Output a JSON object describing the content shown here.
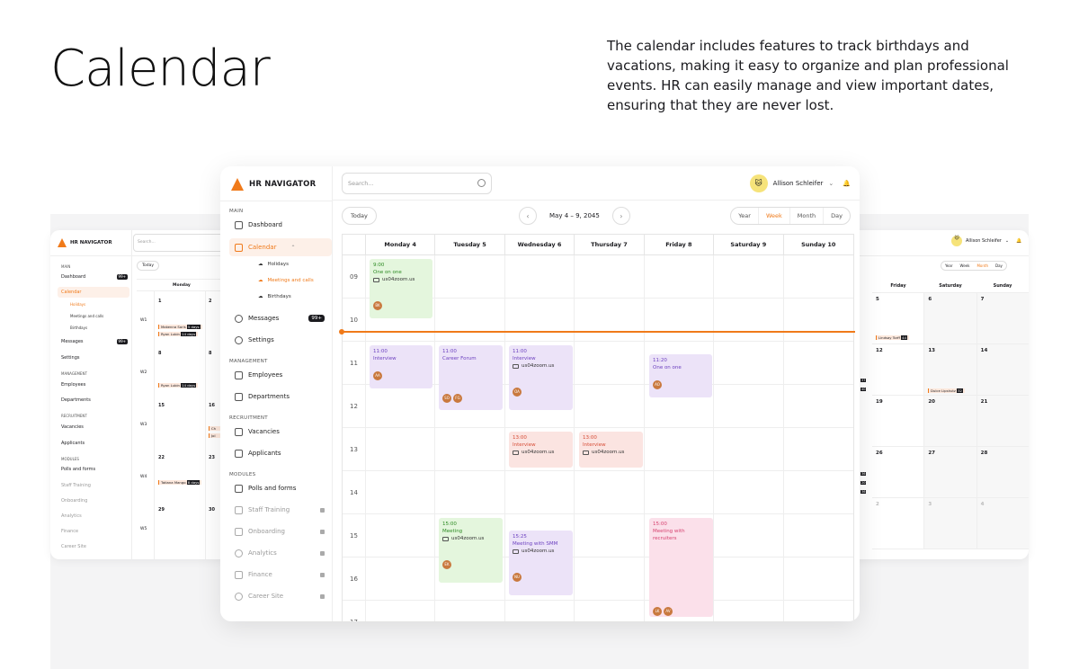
{
  "hero": {
    "title": "Calendar",
    "description": "The calendar includes features to track birthdays and vacations, making it easy to organize and plan professional events. HR can easily manage and view important dates, ensuring that they are never lost."
  },
  "app": {
    "name": "HR NAVIGATOR"
  },
  "search": {
    "placeholder": "Search..."
  },
  "user": {
    "name": "Allison Schleifer"
  },
  "sidebar": {
    "main_label": "MAIN",
    "dashboard": "Dashboard",
    "calendar": "Calendar",
    "holidays": "Holidays",
    "meetings": "Meetings and calls",
    "birthdays": "Birthdays",
    "messages": "Messages",
    "messages_badge": "99+",
    "settings": "Settings",
    "management_label": "MANAGEMENT",
    "employees": "Employees",
    "departments": "Departments",
    "recruitment_label": "RECRUITMENT",
    "vacancies": "Vacancies",
    "applicants": "Applicants",
    "modules_label": "MODULES",
    "polls": "Polls and forms",
    "staff_training": "Staff Training",
    "onboarding": "Onboarding",
    "analytics": "Analytics",
    "finance": "Finance",
    "career_site": "Career Site"
  },
  "controls": {
    "today": "Today",
    "range": "May 4 – 9, 2045",
    "prev": "‹",
    "next": "›",
    "views": [
      "Year",
      "Week",
      "Month",
      "Day"
    ],
    "active_view": "Week"
  },
  "week": {
    "days": [
      "Monday 4",
      "Tuesday 5",
      "Wednesday 6",
      "Thursday 7",
      "Friday 8",
      "Saturday 9",
      "Sunday 10"
    ],
    "hours": [
      "09",
      "10",
      "11",
      "12",
      "13",
      "14",
      "15",
      "16",
      "17"
    ]
  },
  "events": [
    {
      "time": "9:00",
      "title": "One on one",
      "link": "us04zoom.us",
      "avatars": [
        "BK"
      ]
    },
    {
      "time": "11:00",
      "title": "Interview",
      "avatars": [
        "AA"
      ]
    },
    {
      "time": "11:00",
      "title": "Career Forum",
      "avatars": [
        "SO",
        "FG"
      ]
    },
    {
      "time": "11:00",
      "title": "Interview",
      "link": "us04zoom.us",
      "avatars": [
        "OA"
      ]
    },
    {
      "time": "11:20",
      "title": "One on one",
      "avatars": [
        "AO"
      ]
    },
    {
      "time": "13:00",
      "title": "Interview",
      "link": "us04zoom.us"
    },
    {
      "time": "13:00",
      "title": "Interview",
      "link": "us04zoom.us"
    },
    {
      "time": "15:00",
      "title": "Meeting",
      "link": "us04zoom.us",
      "avatars": [
        "EK"
      ]
    },
    {
      "time": "15:25",
      "title": "Meeting with SMM",
      "link": "us04zoom.us",
      "avatars": [
        "NU"
      ]
    },
    {
      "time": "15:00",
      "title": "Meeting with recruiters",
      "avatars": [
        "LK",
        "AV"
      ]
    }
  ],
  "left_card": {
    "sidebar": {
      "main": "MAIN",
      "dashboard": "Dashboard",
      "badge": "99+",
      "calendar": "Calendar",
      "holidays": "Holidays",
      "meetings": "Meetings and calls",
      "birthdays": "Birthdays",
      "messages": "Messages",
      "settings": "Settings",
      "management": "MANAGEMENT",
      "employees": "Employees",
      "departments": "Departments",
      "recruitment": "RECRUITMENT",
      "vacancies": "Vacancies",
      "applicants": "Applicants",
      "modules": "MODULES",
      "polls": "Polls and forms",
      "staff": "Staff Training",
      "onboarding": "Onboarding",
      "analytics": "Analytics",
      "finance": "Finance",
      "career": "Career Site"
    },
    "today": "Today",
    "monday": "Monday",
    "weeks": [
      "W1",
      "W2",
      "W3",
      "W4",
      "W5"
    ],
    "dates": [
      "1",
      "2",
      "8",
      "8",
      "15",
      "16",
      "22",
      "23",
      "29",
      "30"
    ],
    "tags": [
      {
        "name": "Makenna Saris",
        "days": "5 days"
      },
      {
        "name": "Ryan Lubin",
        "days": "14 days"
      },
      {
        "name": "Ryan Lubin",
        "days": "14 days"
      },
      {
        "name": "Tatiana Mango",
        "days": "8 days"
      }
    ],
    "cut": [
      "Ch",
      "Jol"
    ]
  },
  "right_card": {
    "views": [
      "Year",
      "Week",
      "Month",
      "Day"
    ],
    "active_view": "Month",
    "days": [
      "Friday",
      "Saturday",
      "Sunday"
    ],
    "dates": [
      [
        "5",
        "6",
        "7"
      ],
      [
        "12",
        "13",
        "14"
      ],
      [
        "19",
        "20",
        "21"
      ],
      [
        "26",
        "27",
        "28"
      ],
      [
        "2",
        "3",
        "4"
      ]
    ],
    "tags": [
      {
        "name": "Lindsay Torff",
        "count": "44"
      },
      {
        "name": "Dulce Lipshutz",
        "count": "32"
      }
    ],
    "edge_marks": [
      "37",
      "40",
      "36",
      "20",
      "36"
    ]
  },
  "colors": {
    "accent": "#f07a1a"
  }
}
